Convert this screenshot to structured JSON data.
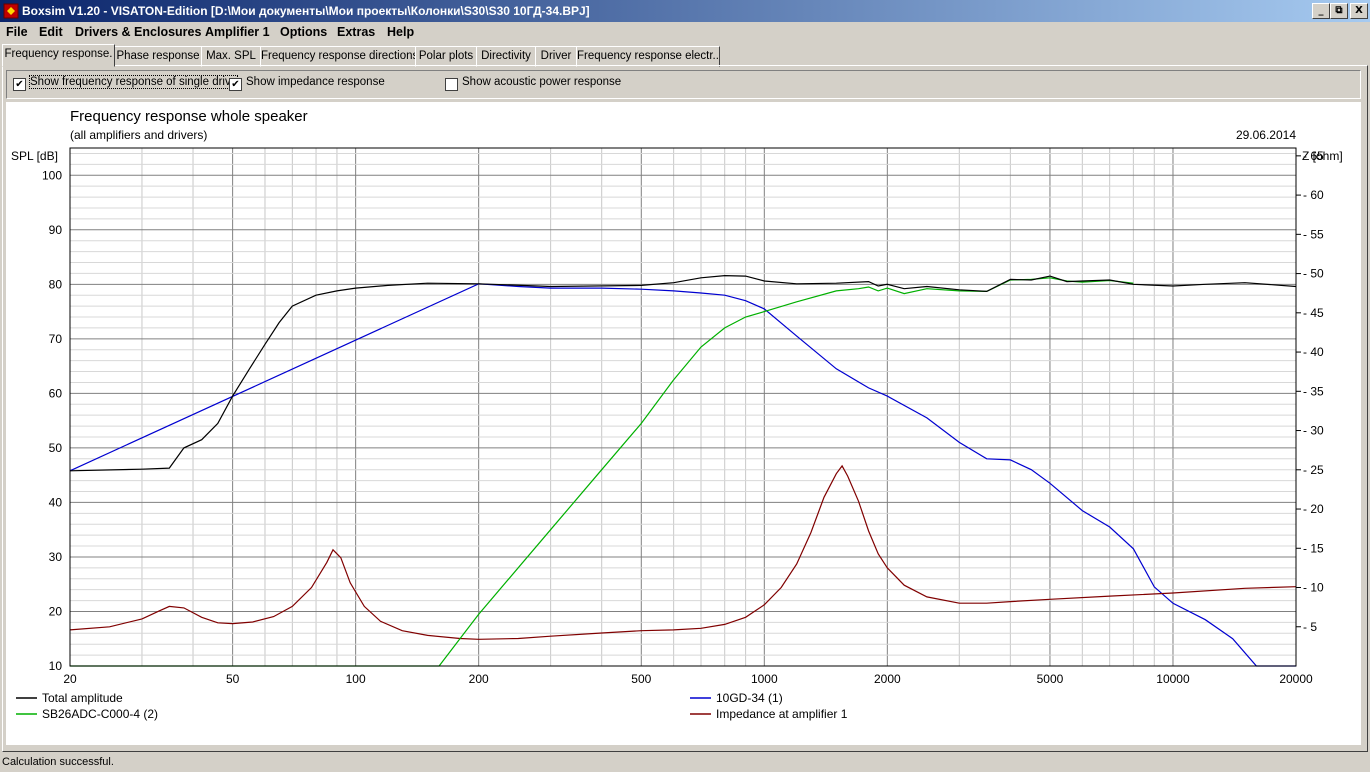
{
  "window": {
    "title": "Boxsim V1.20 - VISATON-Edition [D:\\Мои документы\\Мои проекты\\Колонки\\S30\\S30 10ГД-34.BPJ]",
    "minimize_label": "_",
    "restore_label": "⧉",
    "close_label": "X"
  },
  "menu": [
    "File",
    "Edit",
    "Drivers & Enclosures",
    "Amplifier 1",
    "Options",
    "Extras",
    "Help"
  ],
  "tabs": [
    "Frequency response.",
    "Phase response",
    "Max. SPL",
    "Frequency response directions",
    "Polar plots",
    "Directivity",
    "Driver",
    "Frequency response electr.."
  ],
  "options": {
    "single_drivers": {
      "label": "Show frequency response of single drive",
      "checked": true
    },
    "impedance": {
      "label": "Show impedance response",
      "checked": true
    },
    "acoustic_power": {
      "label": "Show acoustic power response",
      "checked": false
    }
  },
  "status": "Calculation successful.",
  "chart_data": {
    "type": "line",
    "title": "Frequency response whole speaker",
    "subtitle": "(all amplifiers and drivers)",
    "date": "29.06.2014",
    "ylabel": "SPL [dB]",
    "y2label": "Z [ohm]",
    "x_scale": "log",
    "xlim": [
      20,
      20000
    ],
    "ylim": [
      10,
      105
    ],
    "y2lim": [
      0,
      66
    ],
    "grid": true,
    "legend_position": "bottom",
    "x_ticks": [
      20,
      50,
      100,
      200,
      500,
      1000,
      2000,
      5000,
      10000,
      20000
    ],
    "y_ticks": [
      10,
      20,
      30,
      40,
      50,
      60,
      70,
      80,
      90,
      100
    ],
    "y2_ticks": [
      5,
      10,
      15,
      20,
      25,
      30,
      35,
      40,
      45,
      50,
      55,
      60,
      65
    ],
    "series": [
      {
        "name": "Total amplitude",
        "axis": "left",
        "color": "#000000",
        "x": [
          20,
          30,
          35,
          38,
          42,
          46,
          50,
          55,
          60,
          65,
          70,
          80,
          90,
          100,
          120,
          150,
          200,
          300,
          500,
          600,
          700,
          800,
          900,
          1000,
          1200,
          1500,
          1800,
          1900,
          2000,
          2200,
          2500,
          3000,
          3500,
          4000,
          4500,
          5000,
          5500,
          6000,
          7000,
          8000,
          10000,
          12000,
          15000,
          20000
        ],
        "y": [
          45.8,
          46.1,
          46.3,
          50.0,
          51.5,
          54.5,
          59.5,
          64.5,
          69.0,
          73.0,
          76.0,
          78.0,
          78.8,
          79.3,
          79.8,
          80.2,
          80.1,
          79.6,
          79.8,
          80.3,
          81.2,
          81.6,
          81.5,
          80.6,
          80.1,
          80.2,
          80.5,
          79.7,
          80.0,
          79.2,
          79.6,
          79.0,
          78.7,
          80.9,
          80.8,
          81.5,
          80.5,
          80.6,
          80.8,
          80.0,
          79.7,
          80.0,
          80.3,
          79.6
        ]
      },
      {
        "name": "SB26ADC-C000-4 (2)",
        "axis": "left",
        "color": "#00b000",
        "x": [
          20,
          100,
          160,
          200,
          300,
          400,
          500,
          600,
          700,
          800,
          900,
          1000,
          1200,
          1500,
          1700,
          1800,
          1900,
          2000,
          2200,
          2500,
          3000,
          3500,
          4000,
          4500,
          5000,
          5500,
          6000,
          7000,
          8000
        ],
        "y": [
          10,
          10,
          10,
          19.5,
          35.0,
          46.0,
          54.5,
          62.5,
          68.5,
          72.0,
          74.0,
          75.0,
          76.8,
          78.8,
          79.2,
          79.5,
          78.8,
          79.3,
          78.3,
          79.2,
          78.8,
          78.7,
          80.8,
          80.9,
          81.2,
          80.6,
          80.4,
          80.7,
          80.2
        ]
      },
      {
        "name": "10GD-34 (1)",
        "axis": "left",
        "color": "#0000d0",
        "x": [
          20,
          200,
          250,
          300,
          400,
          500,
          600,
          700,
          800,
          900,
          1000,
          1200,
          1500,
          1800,
          2000,
          2500,
          3000,
          3500,
          4000,
          4500,
          5000,
          6000,
          7000,
          8000,
          9000,
          10000,
          12000,
          14000,
          16000,
          20000
        ],
        "y": [
          45.8,
          80.1,
          79.6,
          79.3,
          79.3,
          79.1,
          78.8,
          78.4,
          78.0,
          77.0,
          75.5,
          70.5,
          64.5,
          61.0,
          59.5,
          55.5,
          51.0,
          48.0,
          47.8,
          46.0,
          43.5,
          38.5,
          35.5,
          31.5,
          24.5,
          21.5,
          18.5,
          15.0,
          10.0,
          10.0
        ]
      },
      {
        "name": "Impedance at amplifier 1",
        "axis": "right",
        "color": "#800000",
        "x": [
          20,
          25,
          30,
          33,
          35,
          38,
          42,
          46,
          50,
          56,
          63,
          70,
          78,
          85,
          88,
          92,
          97,
          105,
          115,
          130,
          150,
          180,
          200,
          250,
          300,
          400,
          500,
          600,
          700,
          800,
          900,
          1000,
          1100,
          1200,
          1300,
          1400,
          1500,
          1550,
          1600,
          1700,
          1800,
          1900,
          2000,
          2200,
          2500,
          3000,
          3500,
          4000,
          5000,
          7000,
          10000,
          15000,
          20000
        ],
        "y": [
          4.6,
          5.0,
          6.0,
          7.0,
          7.6,
          7.4,
          6.2,
          5.5,
          5.4,
          5.6,
          6.3,
          7.6,
          10.0,
          13.2,
          14.8,
          13.8,
          10.6,
          7.6,
          5.7,
          4.5,
          3.9,
          3.5,
          3.4,
          3.5,
          3.8,
          4.2,
          4.5,
          4.6,
          4.8,
          5.3,
          6.2,
          7.8,
          10.0,
          13.0,
          17.0,
          21.5,
          24.5,
          25.5,
          24.2,
          21.0,
          17.2,
          14.3,
          12.5,
          10.3,
          8.8,
          8.0,
          8.0,
          8.2,
          8.5,
          8.9,
          9.3,
          9.9,
          10.1
        ]
      }
    ]
  }
}
